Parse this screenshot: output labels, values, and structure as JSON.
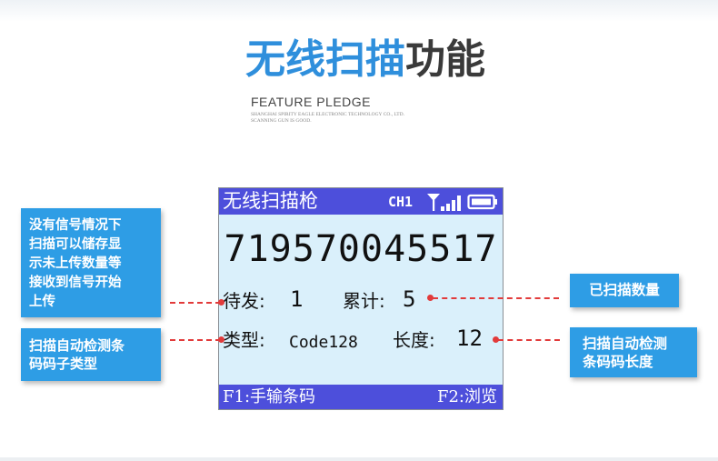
{
  "heading": {
    "title_highlight": "无线扫描",
    "title_rest": "功能",
    "subtitle": "FEATURE PLEDGE",
    "company_line1": "SHANGHAI SPIRITY EAGLE ELECTRONIC TECHNOLOGY CO., LTD.",
    "company_line2": "SCANNING GUN IS GOOD."
  },
  "screen": {
    "status_title": "无线扫描枪",
    "channel": "CH1",
    "signal_icon": "signal-bars-icon",
    "battery_icon": "battery-icon",
    "barcode_number": "719570045517",
    "pending_label": "待发:",
    "pending_value": "1",
    "total_label": "累计:",
    "total_value": "5",
    "type_label": "类型:",
    "type_value": "Code128",
    "length_label": "长度:",
    "length_value": "12",
    "f1_label": "F1:手输条码",
    "f2_label": "F2:浏览"
  },
  "callouts": {
    "no_signal_lines": [
      "没有信号情况下",
      "扫描可以储存显",
      "示未上传数量等",
      "接收到信号开始",
      "上传"
    ],
    "auto_type_lines": [
      "扫描自动检测条",
      "码码子类型"
    ],
    "scanned_count": "已扫描数量",
    "auto_length_lines": [
      "扫描自动检测",
      "条码码长度"
    ]
  },
  "colors": {
    "accent_blue": "#2e9de5",
    "screen_bar": "#4d4fdb",
    "screen_bg": "#daf0fb",
    "connector_red": "#e23b3b"
  }
}
